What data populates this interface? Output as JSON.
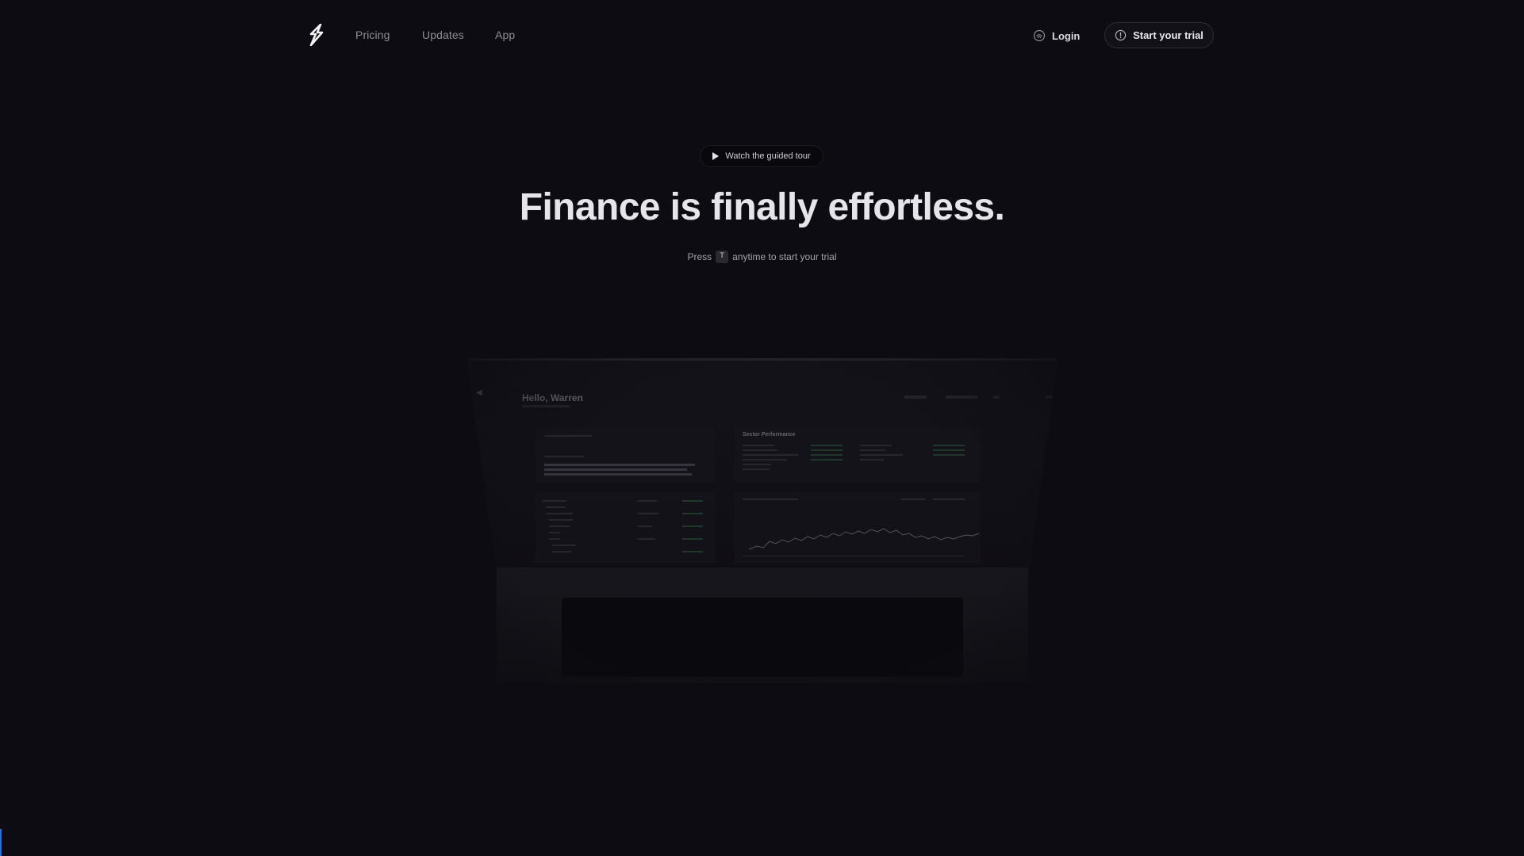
{
  "nav": {
    "links": [
      "Pricing",
      "Updates",
      "App"
    ],
    "login": "Login",
    "start_trial": "Start your trial"
  },
  "hero": {
    "tour_button": "Watch the guided tour",
    "headline": "Finance is finally effortless.",
    "sub_before": "Press",
    "sub_key": "T",
    "sub_after": "anytime to start your trial"
  },
  "preview": {
    "greeting": "Hello, Warren",
    "sector_title": "Sector Performance"
  },
  "colors": {
    "background": "#0d0c12",
    "text": "#e6e6ea",
    "muted": "#8e8d96"
  }
}
